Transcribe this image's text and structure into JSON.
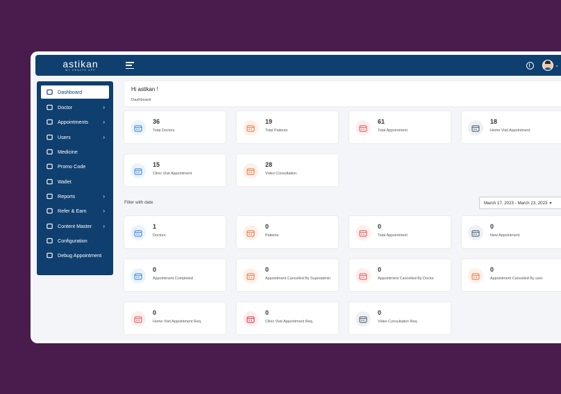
{
  "app": {
    "logo": "astikan",
    "logo_tagline": "MY HEALTH APP"
  },
  "sidebar": {
    "items": [
      {
        "label": "Dashboard",
        "icon": "home-icon",
        "has_arrow": false,
        "active": true
      },
      {
        "label": "Doctor",
        "icon": "doctor-icon",
        "has_arrow": true
      },
      {
        "label": "Appointments",
        "icon": "appointments-icon",
        "has_arrow": true
      },
      {
        "label": "Users",
        "icon": "user-icon",
        "has_arrow": true
      },
      {
        "label": "Medicine",
        "icon": "medicine-icon",
        "has_arrow": false
      },
      {
        "label": "Promo Code",
        "icon": "tag-icon",
        "has_arrow": false
      },
      {
        "label": "Wallet",
        "icon": "wallet-icon",
        "has_arrow": false
      },
      {
        "label": "Reports",
        "icon": "report-icon",
        "has_arrow": true
      },
      {
        "label": "Refer & Earn",
        "icon": "refer-icon",
        "has_arrow": true
      },
      {
        "label": "Content Master",
        "icon": "content-icon",
        "has_arrow": true
      },
      {
        "label": "Configuration",
        "icon": "gear-icon",
        "has_arrow": false
      },
      {
        "label": "Debug Appointment",
        "icon": "calendar-icon",
        "has_arrow": false
      }
    ],
    "arrow": "›"
  },
  "welcome": {
    "title": "Hi astikan !",
    "breadcrumb": "Dashboard"
  },
  "stats": [
    {
      "value": "36",
      "label": "Total Doctors",
      "icon": "doctors-icon",
      "tint": "#eaf3fb",
      "color": "#4a90d9"
    },
    {
      "value": "19",
      "label": "Total Patients",
      "icon": "patients-icon",
      "tint": "#fdf0e8",
      "color": "#e9855a"
    },
    {
      "value": "61",
      "label": "Total Appointment",
      "icon": "calendar-icon",
      "tint": "#fdeeee",
      "color": "#e26a6a"
    },
    {
      "value": "18",
      "label": "Home Visit Appointment",
      "icon": "home-visit-icon",
      "tint": "#eef0f3",
      "color": "#5a6b80"
    },
    {
      "value": "15",
      "label": "Clinic Visit Appointment",
      "icon": "clinic-icon",
      "tint": "#eaf3fb",
      "color": "#4a90d9"
    },
    {
      "value": "28",
      "label": "Video Consultation",
      "icon": "video-icon",
      "tint": "#fdf0e8",
      "color": "#e9855a"
    }
  ],
  "filter": {
    "label": "Filter with date",
    "date_range": "March 17, 2023 - March 23, 2023",
    "dropdown_glyph": "▾"
  },
  "filtered_stats": [
    {
      "value": "1",
      "label": "Doctors",
      "icon": "doctor-icon",
      "tint": "#eaf3fb",
      "color": "#4a90d9"
    },
    {
      "value": "0",
      "label": "Patients",
      "icon": "patients-icon",
      "tint": "#fdf0e8",
      "color": "#e9855a"
    },
    {
      "value": "0",
      "label": "Total Appointment",
      "icon": "calendar-icon",
      "tint": "#fdeeee",
      "color": "#e26a6a"
    },
    {
      "value": "0",
      "label": "New Appointment",
      "icon": "calendar-icon",
      "tint": "#eef0f3",
      "color": "#5a6b80"
    },
    {
      "value": "0",
      "label": "Appointment Completed",
      "icon": "calendar-check-icon",
      "tint": "#eaf3fb",
      "color": "#4a90d9"
    },
    {
      "value": "0",
      "label": "Appointment Cancelled By Superadmin",
      "icon": "calendar-cancel-icon",
      "tint": "#fdf0e8",
      "color": "#e9855a"
    },
    {
      "value": "0",
      "label": "Appointment Cancelled By Doctor",
      "icon": "calendar-cancel-icon",
      "tint": "#fdeeee",
      "color": "#e26a6a"
    },
    {
      "value": "0",
      "label": "Appointment Cancelled By user",
      "icon": "calendar-cancel-icon",
      "tint": "#fdf0e8",
      "color": "#e9855a"
    },
    {
      "value": "0",
      "label": "Home Visit Appointment Req.",
      "icon": "home-visit-icon",
      "tint": "#fdeeee",
      "color": "#e26a6a"
    },
    {
      "value": "0",
      "label": "Clinic Visit Appointment Req.",
      "icon": "clinic-icon",
      "tint": "#fdeeee",
      "color": "#d9475f"
    },
    {
      "value": "0",
      "label": "Video Consultation Req.",
      "icon": "video-icon",
      "tint": "#eef0f3",
      "color": "#5a6b80"
    }
  ],
  "colors": {
    "brand": "#0f3f6e",
    "background": "#4a1b4d"
  }
}
